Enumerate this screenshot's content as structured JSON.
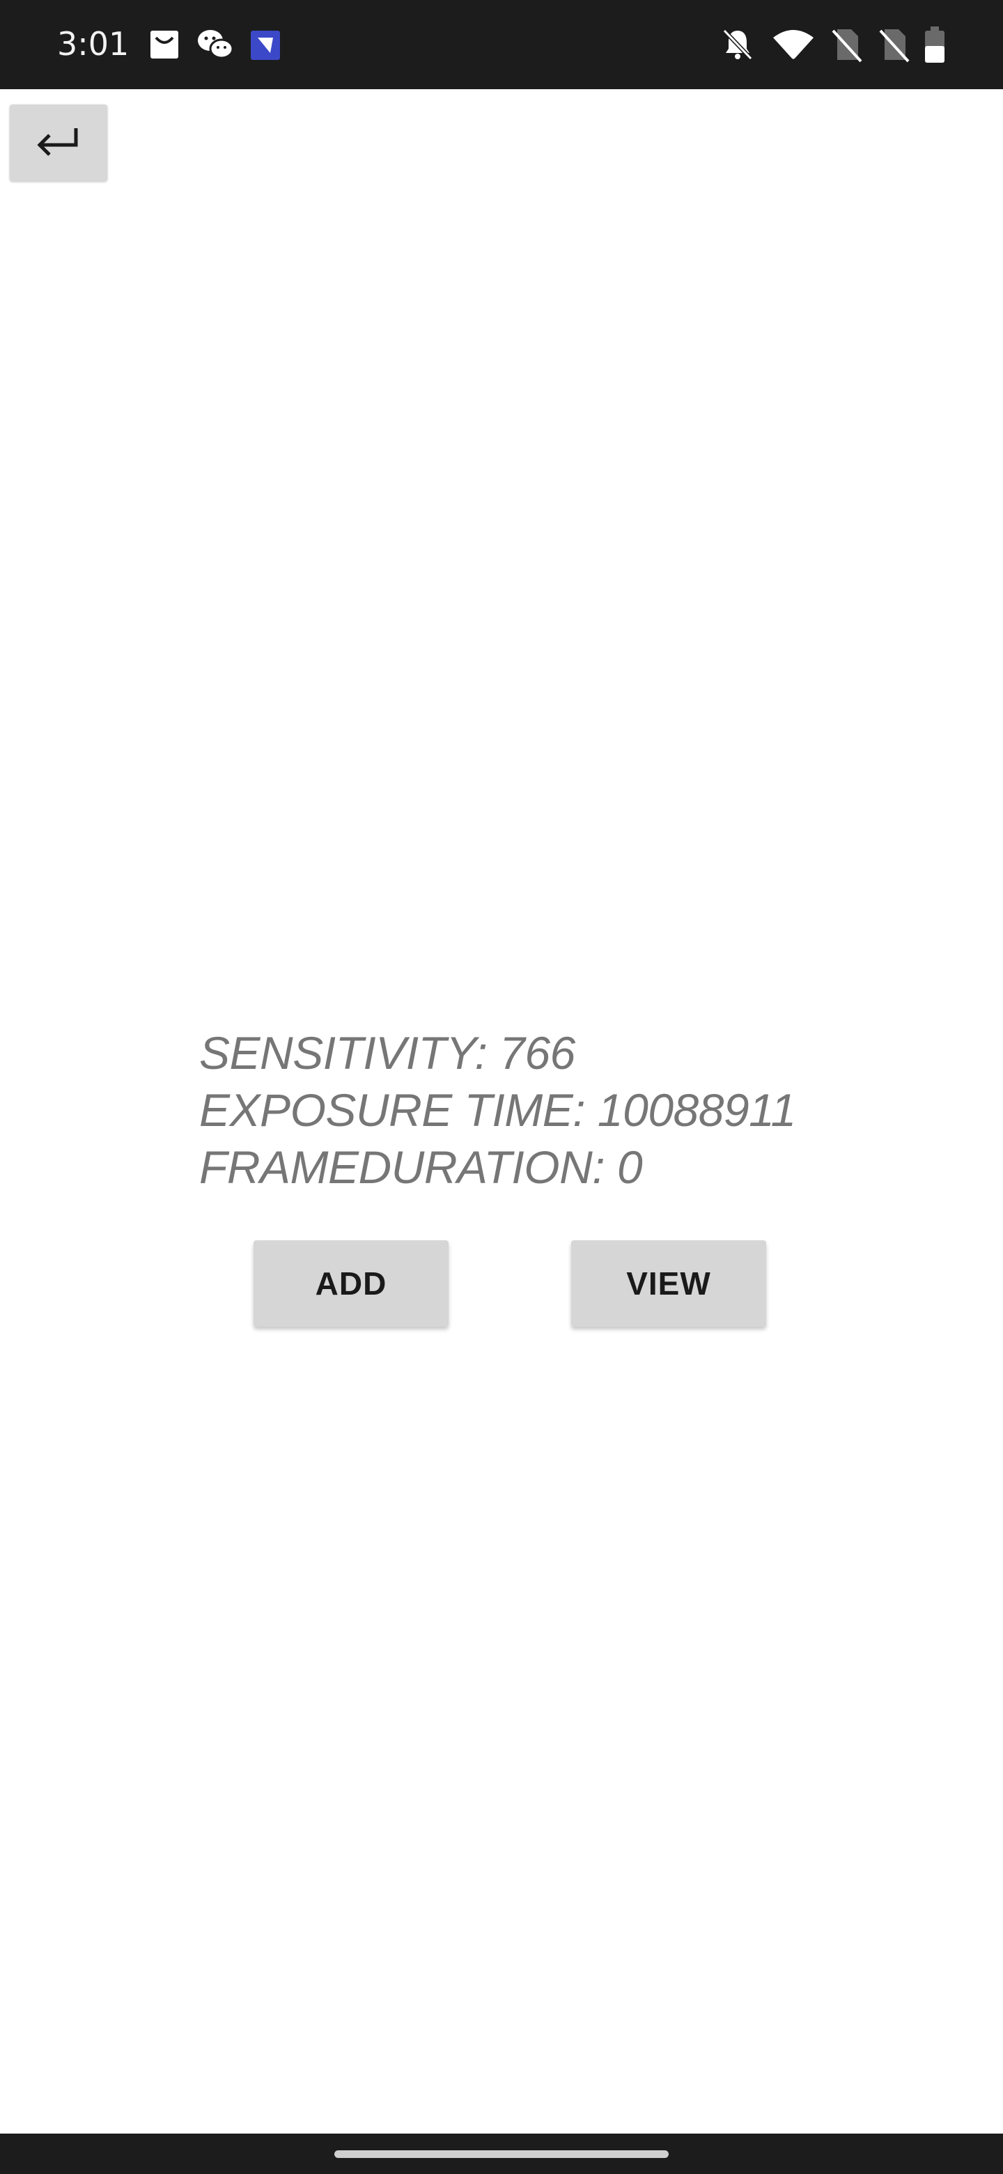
{
  "status_bar": {
    "time": "3:01",
    "left_icons": [
      "mail-icon",
      "wechat-icon",
      "app-notification-icon"
    ],
    "right_icons": [
      "bell-muted-icon",
      "wifi-icon",
      "no-sim-icon",
      "no-sim-icon",
      "battery-icon"
    ]
  },
  "toolbar": {
    "back_icon": "return-arrow-icon"
  },
  "camera_info": {
    "sensitivity": "SENSITIVITY: 766",
    "exposure_time": "EXPOSURE TIME: 10088911",
    "frame_duration": "FRAMEDURATION: 0"
  },
  "actions": {
    "add_label": "ADD",
    "view_label": "VIEW"
  },
  "colors": {
    "status_bar_bg": "#1c1c1c",
    "button_bg": "#d6d6d6",
    "info_text": "#767676"
  }
}
